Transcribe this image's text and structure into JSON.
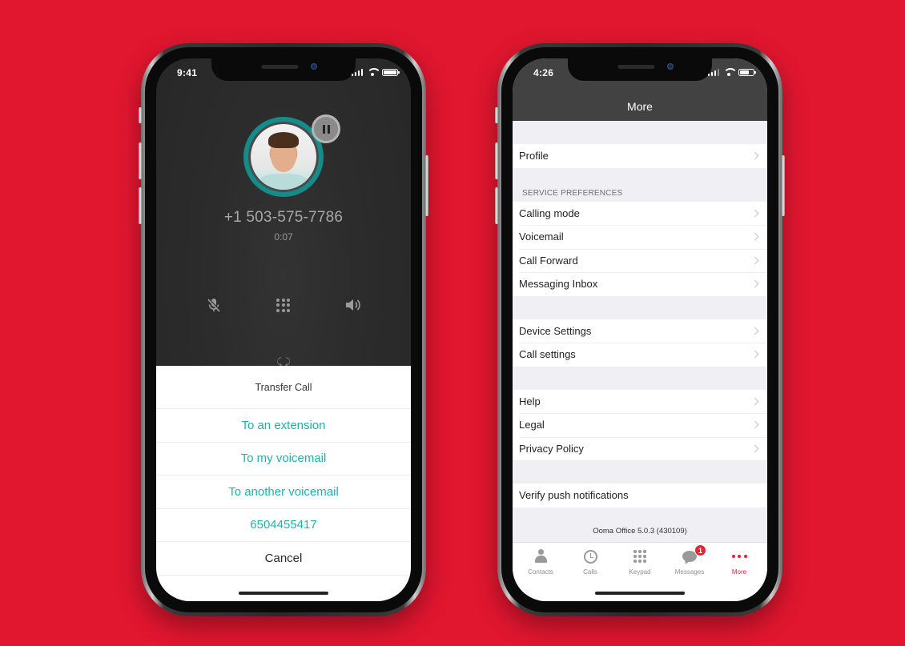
{
  "background_color": "#e1162f",
  "left_phone": {
    "status_bar": {
      "time": "9:41"
    },
    "call": {
      "caller_number": "+1 503-575-7786",
      "duration": "0:07",
      "avatar_ring_color": "#148c8a",
      "controls": [
        {
          "icon": "mute-microphone-icon",
          "label": "Mute"
        },
        {
          "icon": "keypad-icon",
          "label": "Keypad"
        },
        {
          "icon": "speaker-icon",
          "label": "Speaker"
        }
      ],
      "swap_hint": "⤹ ⤸"
    },
    "action_sheet": {
      "title": "Transfer Call",
      "options": [
        "To an extension",
        "To my voicemail",
        "To another voicemail",
        "6504455417"
      ],
      "cancel": "Cancel",
      "accent_color": "#1cb5ad"
    }
  },
  "right_phone": {
    "status_bar": {
      "time": "4:26"
    },
    "nav_title": "More",
    "sections": {
      "profile": "Profile",
      "service_preferences_header": "SERVICE PREFERENCES",
      "service_preferences": [
        "Calling mode",
        "Voicemail",
        "Call Forward",
        "Messaging Inbox"
      ],
      "device": [
        "Device Settings",
        "Call settings"
      ],
      "info": [
        "Help",
        "Legal",
        "Privacy Policy"
      ],
      "verify": "Verify push notifications"
    },
    "version": "Ooma Office 5.0.3 (430109)",
    "tab_bar": {
      "tabs": [
        {
          "label": "Contacts",
          "icon": "person-icon"
        },
        {
          "label": "Calls",
          "icon": "clock-icon"
        },
        {
          "label": "Keypad",
          "icon": "keypad-icon"
        },
        {
          "label": "Messages",
          "icon": "chat-bubble-icon",
          "badge": "1"
        },
        {
          "label": "More",
          "icon": "more-dots-icon",
          "active": true
        }
      ],
      "active_color": "#e5242f"
    }
  }
}
